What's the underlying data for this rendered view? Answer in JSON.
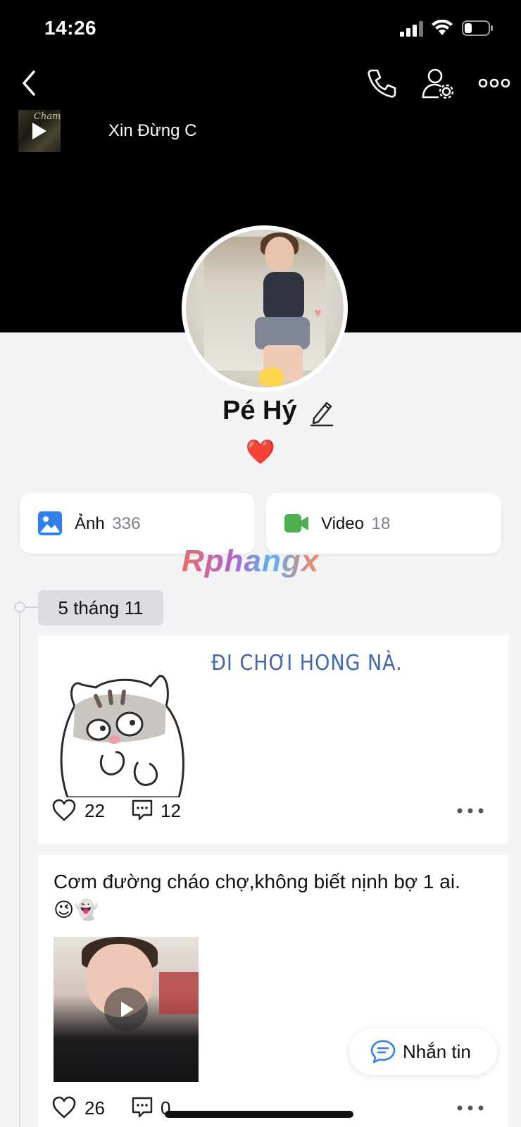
{
  "status_bar": {
    "time": "14:26"
  },
  "music": {
    "title": "Xin Đừng C",
    "cover_text": "Cham"
  },
  "profile": {
    "name": "Pé Hý",
    "bio": "❤️"
  },
  "media": {
    "photos": {
      "label": "Ảnh",
      "count": "336"
    },
    "videos": {
      "label": "Video",
      "count": "18"
    }
  },
  "watermark": "Rphangx",
  "timeline": {
    "date": "5 tháng 11"
  },
  "posts": [
    {
      "sticker_text": "ĐI CHƠI HONG NÀ.",
      "likes": "22",
      "comments": "12"
    },
    {
      "text": "Cơm đường cháo chợ,không biết nịnh bợ 1 ai.",
      "emojis": "😉👻",
      "likes": "26",
      "comments": "0"
    }
  ],
  "message_button": {
    "label": "Nhắn tin"
  },
  "colors": {
    "header_bg": "#000000",
    "accent_blue": "#2f80ed",
    "video_green": "#4caf50",
    "background": "#f2f3f5"
  }
}
